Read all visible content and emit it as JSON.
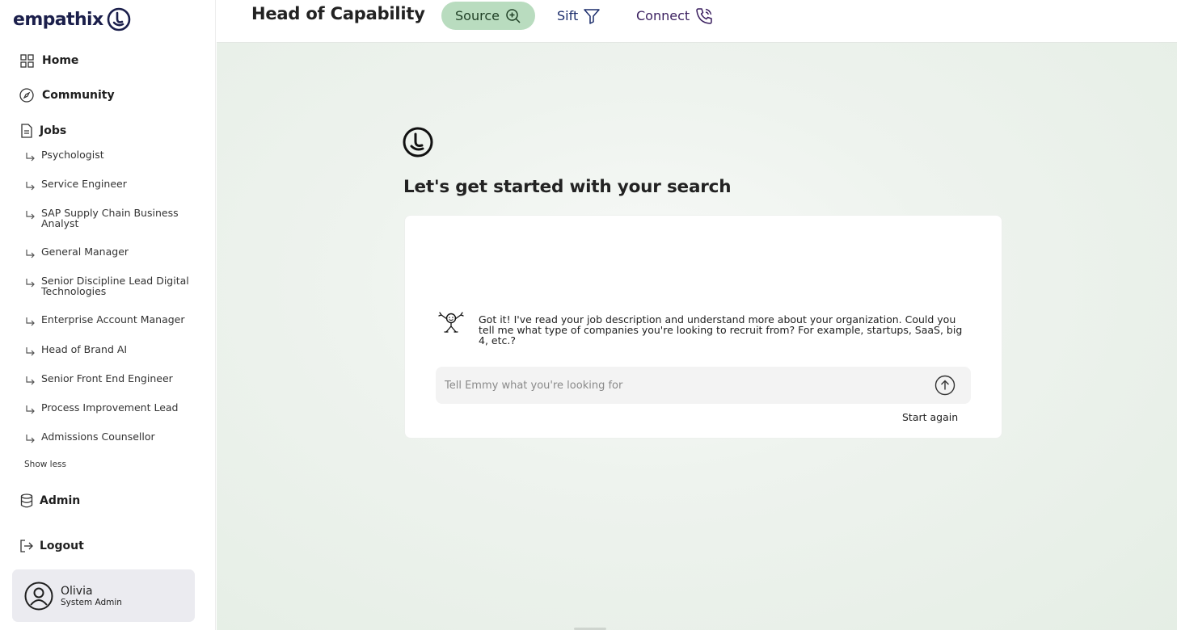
{
  "brand": {
    "name": "empathix"
  },
  "sidebar": {
    "nav": {
      "home": "Home",
      "community": "Community",
      "jobs": "Jobs",
      "admin": "Admin",
      "logout": "Logout"
    },
    "jobs": [
      "Psychologist",
      "Service Engineer",
      "SAP Supply Chain Business Analyst",
      "General Manager",
      "Senior Discipline Lead Digital Technologies",
      "Enterprise Account Manager",
      "Head of Brand AI",
      "Senior Front End Engineer",
      "Process Improvement Lead",
      "Admissions Counsellor"
    ],
    "show_less": "Show less"
  },
  "user": {
    "name": "Olivia",
    "role": "System Admin"
  },
  "header": {
    "title": "Head of Capability",
    "tabs": {
      "source": "Source",
      "sift": "Sift",
      "connect": "Connect"
    }
  },
  "main": {
    "headline": "Let's get started with your search",
    "message": "Got it! I've read your job description and understand more about your organization. Could you tell me what type of companies you're looking to recruit from? For example, startups, SaaS, big 4, etc.?",
    "input_placeholder": "Tell Emmy what you're looking for",
    "start_again": "Start again"
  },
  "colors": {
    "brand": "#1b1f4b",
    "source_tab_bg": "#b9dcbf",
    "sift": "#1b2d6b",
    "connect": "#3a1f5f",
    "card_bg": "#ffffff"
  }
}
